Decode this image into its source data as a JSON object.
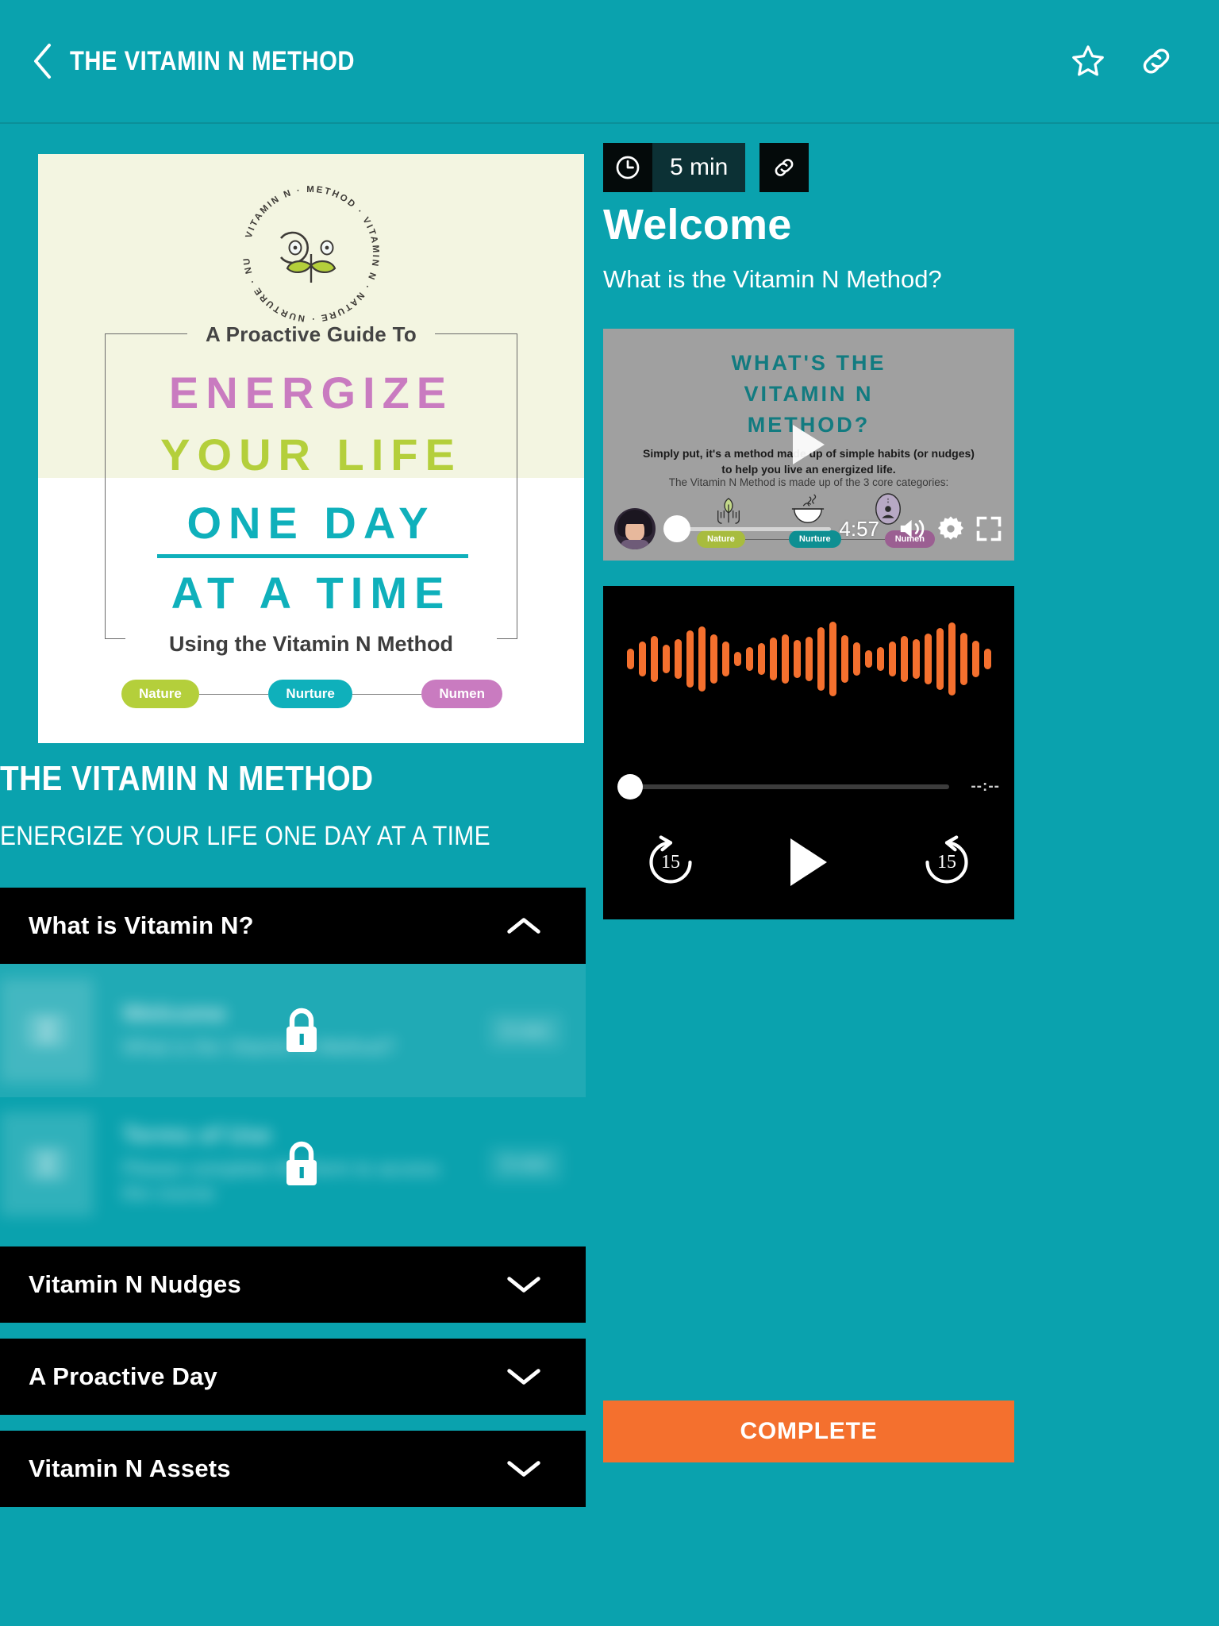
{
  "topbar": {
    "back_icon": "chevron-left-icon",
    "title": "THE VITAMIN N METHOD",
    "favorite_icon": "star-icon",
    "share_icon": "link-icon"
  },
  "cover": {
    "logo_ring_text": "VITAMIN N · METHOD · VITAMIN N · NATURE · NURTURE · NUMEN ·",
    "kicker": "A Proactive Guide To",
    "line1": "ENERGIZE",
    "line2": "YOUR LIFE",
    "line3": "ONE DAY",
    "line4": "AT A TIME",
    "subtitle": "Using the Vitamin N Method",
    "pills": [
      "Nature",
      "Nurture",
      "Numen"
    ],
    "colors": {
      "paper": "#f3f5e1",
      "energize": "#c97bc0",
      "yourlife": "#b4cf3b",
      "oneday": "#0fb0bb",
      "nature": "#b4cf3b",
      "nurture": "#0fb0bb",
      "numen": "#c97bc0"
    }
  },
  "course": {
    "title": "THE VITAMIN N METHOD",
    "subtitle": "ENERGIZE YOUR LIFE ONE DAY AT A TIME"
  },
  "accordion": {
    "sections": [
      {
        "label": "What is Vitamin N?",
        "expanded": true,
        "chevron": "chevron-up-icon",
        "lessons": [
          {
            "name": "Welcome",
            "description": "What is the Vitamin N Method?",
            "duration": "5 min",
            "locked": true,
            "icon": "book-icon",
            "lock_icon": "lock-icon"
          },
          {
            "name": "Terms of Use",
            "description": "Please complete this form to access the course",
            "duration": "5 min",
            "locked": true,
            "icon": "book-icon",
            "lock_icon": "lock-icon"
          }
        ]
      },
      {
        "label": "Vitamin N Nudges",
        "expanded": false,
        "chevron": "chevron-down-icon",
        "lessons": []
      },
      {
        "label": "A Proactive Day",
        "expanded": false,
        "chevron": "chevron-down-icon",
        "lessons": []
      },
      {
        "label": "Vitamin N Assets",
        "expanded": false,
        "chevron": "chevron-down-icon",
        "lessons": []
      }
    ]
  },
  "lesson": {
    "duration_badge": "5 min",
    "clock_icon": "clock-icon",
    "link_icon": "link-icon",
    "title": "Welcome",
    "subtitle": "What is the Vitamin N Method?"
  },
  "video": {
    "heading_line1": "WHAT'S THE",
    "heading_line2": "VITAMIN N",
    "heading_line3": "METHOD?",
    "body_line1": "Simply put, it's a method made up of simple habits (or nudges)",
    "body_line2": "to help you live an energized life.",
    "body_line3": "The Vitamin N Method is made up of the 3 core categories:",
    "pills": [
      "Nature",
      "Nurture",
      "Numen"
    ],
    "play_icon": "play-icon",
    "time_remaining": "4:57",
    "volume_icon": "volume-icon",
    "settings_icon": "gear-icon",
    "fullscreen_icon": "fullscreen-icon",
    "avatar": "presenter-avatar",
    "progress_percent": 0
  },
  "audio": {
    "waveform_color": "#f4702e",
    "waveform_bars": [
      26,
      44,
      58,
      36,
      50,
      72,
      82,
      62,
      44,
      18,
      30,
      40,
      54,
      62,
      48,
      56,
      80,
      94,
      60,
      42,
      22,
      30,
      44,
      58,
      50,
      64,
      78,
      92,
      66,
      46,
      26
    ],
    "elapsed": "--:--",
    "progress_percent": 0,
    "rewind_label": "15",
    "forward_label": "15",
    "rewind_icon": "rewind-15-icon",
    "forward_icon": "forward-15-icon",
    "play_icon": "play-icon"
  },
  "footer": {
    "complete_label": "COMPLETE",
    "complete_color": "#f4702e"
  },
  "theme": {
    "background": "#0aa2ae",
    "panel_black": "#000000",
    "accent_orange": "#f4702e"
  }
}
